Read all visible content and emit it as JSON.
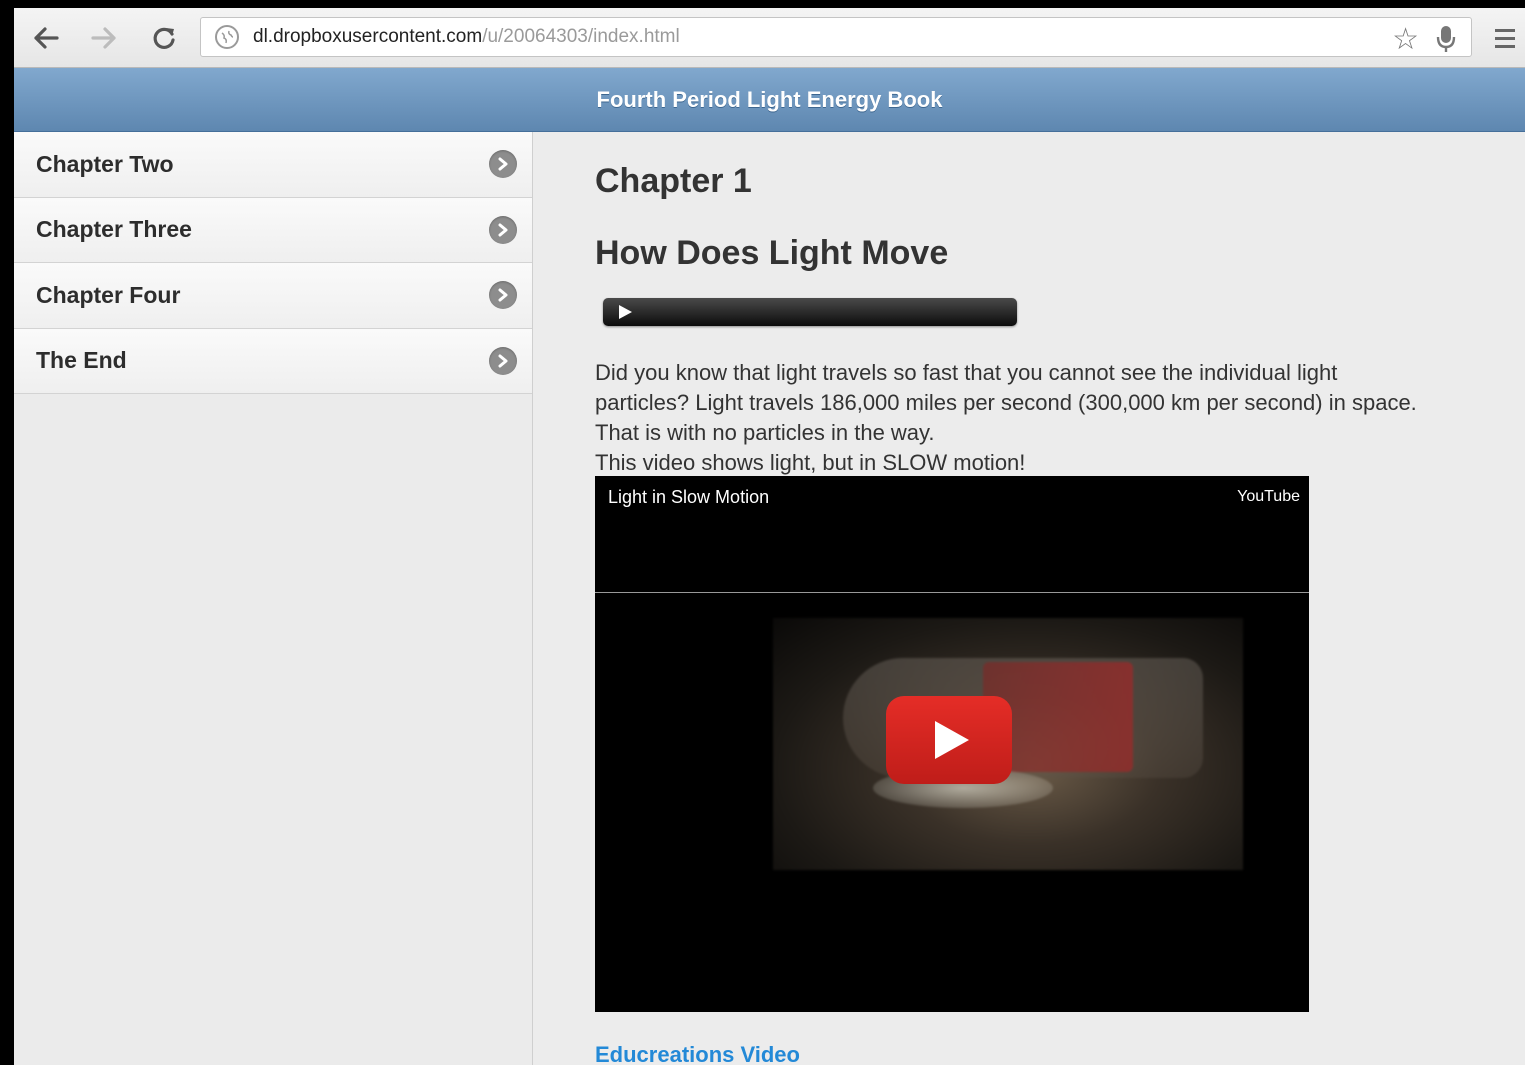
{
  "browser": {
    "url_host": "dl.dropboxusercontent.com",
    "url_path": "/u/20064303/index.html"
  },
  "header": {
    "title": "Fourth Period Light Energy Book"
  },
  "sidebar": {
    "items": [
      {
        "label": "Chapter Two"
      },
      {
        "label": "Chapter Three"
      },
      {
        "label": "Chapter Four"
      },
      {
        "label": "The End"
      }
    ]
  },
  "main": {
    "chapter_title": "Chapter 1",
    "section_title": "How Does Light Move",
    "paragraph_1": "Did you know that light travels so fast that you cannot see the individual light particles? Light travels 186,000 miles per second (300,000 km per second) in space. That is with no particles in the way.",
    "paragraph_2": "This video shows light, but in SLOW motion!",
    "video": {
      "title": "Light in Slow Motion",
      "brand": "YouTube"
    },
    "link_label": "Educreations Video"
  },
  "colors": {
    "header_blue": "#6f98c0",
    "link_blue": "#2389d7",
    "play_red": "#e52d27"
  }
}
